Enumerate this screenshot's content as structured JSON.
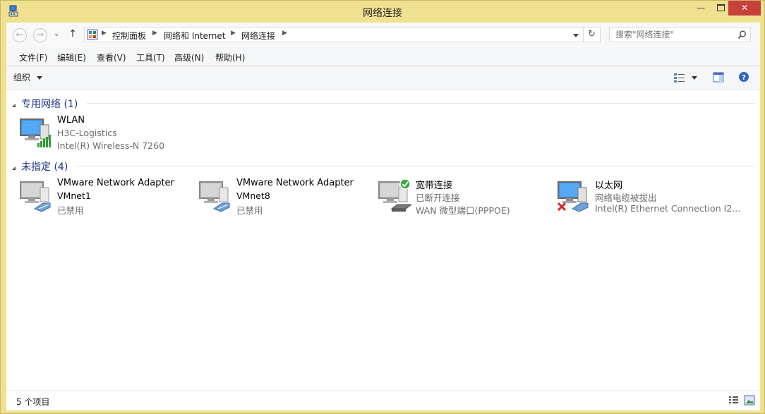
{
  "window": {
    "title": "网络连接"
  },
  "nav": {
    "back_icon": "arrow-left-icon",
    "forward_icon": "arrow-right-icon",
    "up_icon": "arrow-up-icon",
    "breadcrumb": [
      "控制面板",
      "网络和 Internet",
      "网络连接"
    ],
    "search_placeholder": "搜索\"网络连接\""
  },
  "menu": [
    "文件(F)",
    "编辑(E)",
    "查看(V)",
    "工具(T)",
    "高级(N)",
    "帮助(H)"
  ],
  "command": {
    "organize_label": "组织"
  },
  "groups": [
    {
      "title": "专用网络 (1)",
      "items": [
        {
          "name": "WLAN",
          "line2": "H3C-Logistics",
          "line3": "Intel(R) Wireless-N 7260",
          "icon": "wireless-network-icon"
        }
      ]
    },
    {
      "title": "未指定 (4)",
      "items": [
        {
          "name": "VMware Network Adapter",
          "line2": "VMnet1",
          "line3": "已禁用",
          "icon": "ethernet-adapter-disabled-icon"
        },
        {
          "name": "VMware Network Adapter",
          "line2": "VMnet8",
          "line3": "已禁用",
          "icon": "ethernet-adapter-disabled-icon"
        },
        {
          "name": "宽带连接",
          "line2": "已断开连接",
          "line3": "WAN 微型端口(PPPOE)",
          "icon": "broadband-connection-icon"
        },
        {
          "name": "以太网",
          "line2": "网络电缆被拔出",
          "line3": "Intel(R) Ethernet Connection I2...",
          "icon": "ethernet-unplugged-icon"
        }
      ]
    }
  ],
  "status": {
    "count": "5 个项目"
  },
  "colors": {
    "titlebar": "#f0e191",
    "close_button": "#c7403a",
    "group_title": "#1e3287"
  }
}
